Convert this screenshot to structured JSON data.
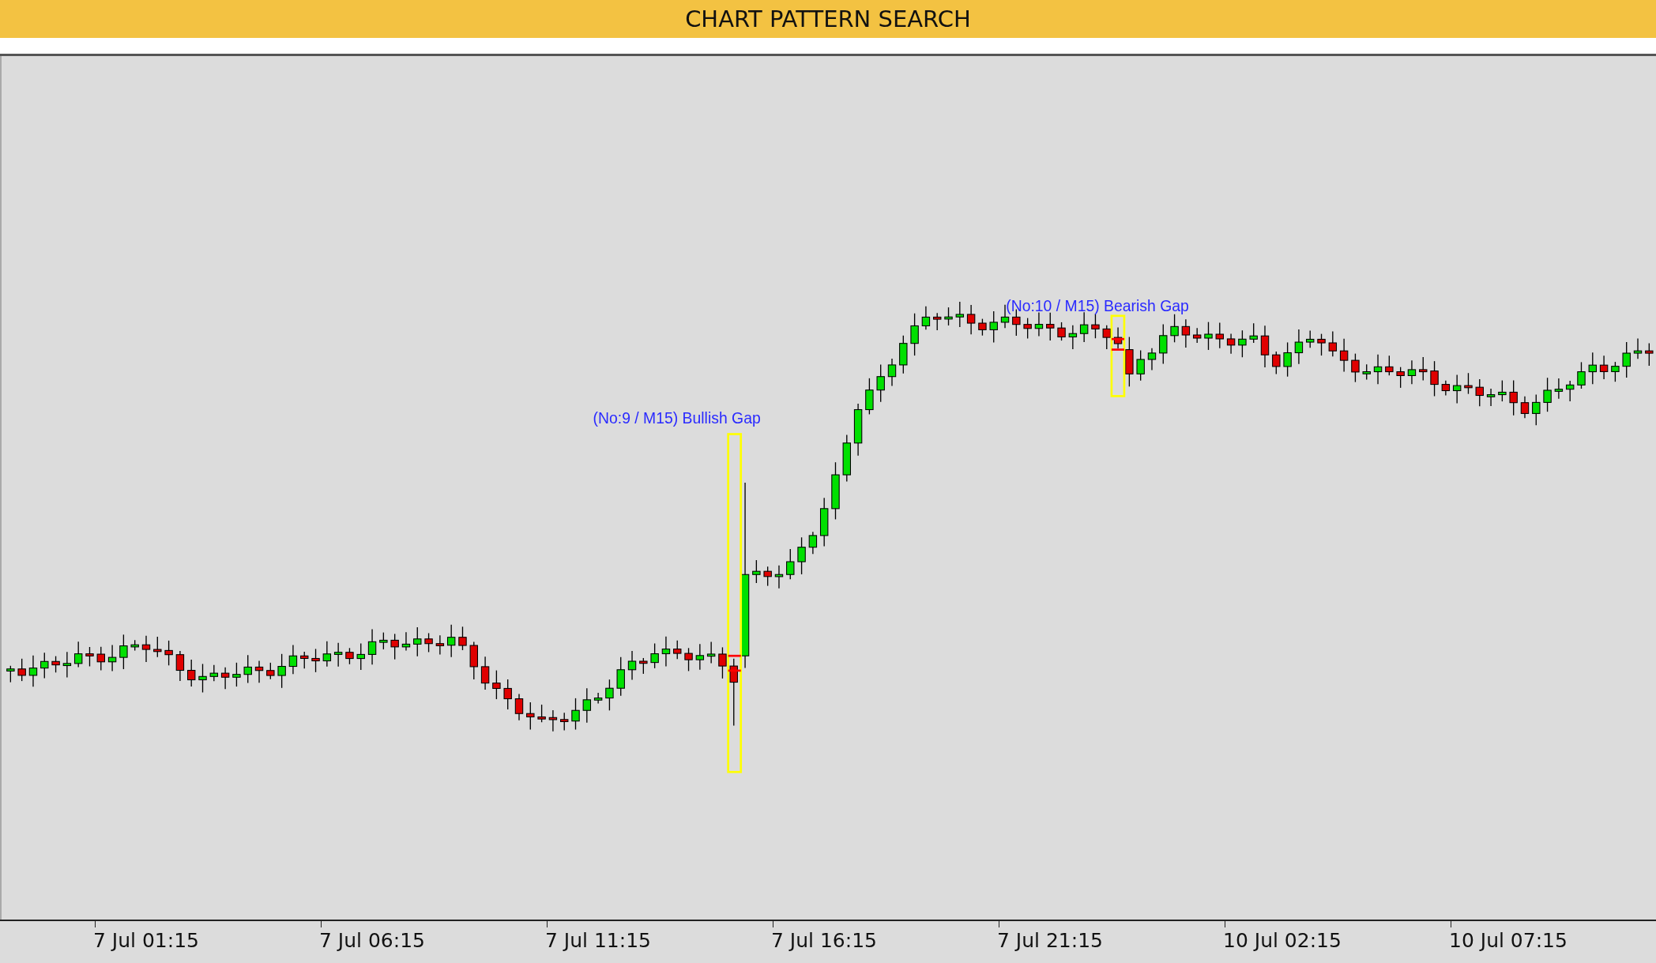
{
  "header": {
    "title": "CHART PATTERN SEARCH"
  },
  "annotations": [
    {
      "label": "(No:9 / M15) Bullish Gap"
    },
    {
      "label": "(No:10 / M15) Bearish Gap"
    }
  ],
  "x_axis": {
    "labels": [
      "7 Jul 01:15",
      "7 Jul 06:15",
      "7 Jul 11:15",
      "7 Jul 16:15",
      "7 Jul 21:15",
      "10 Jul 02:15",
      "10 Jul 07:15"
    ]
  }
}
